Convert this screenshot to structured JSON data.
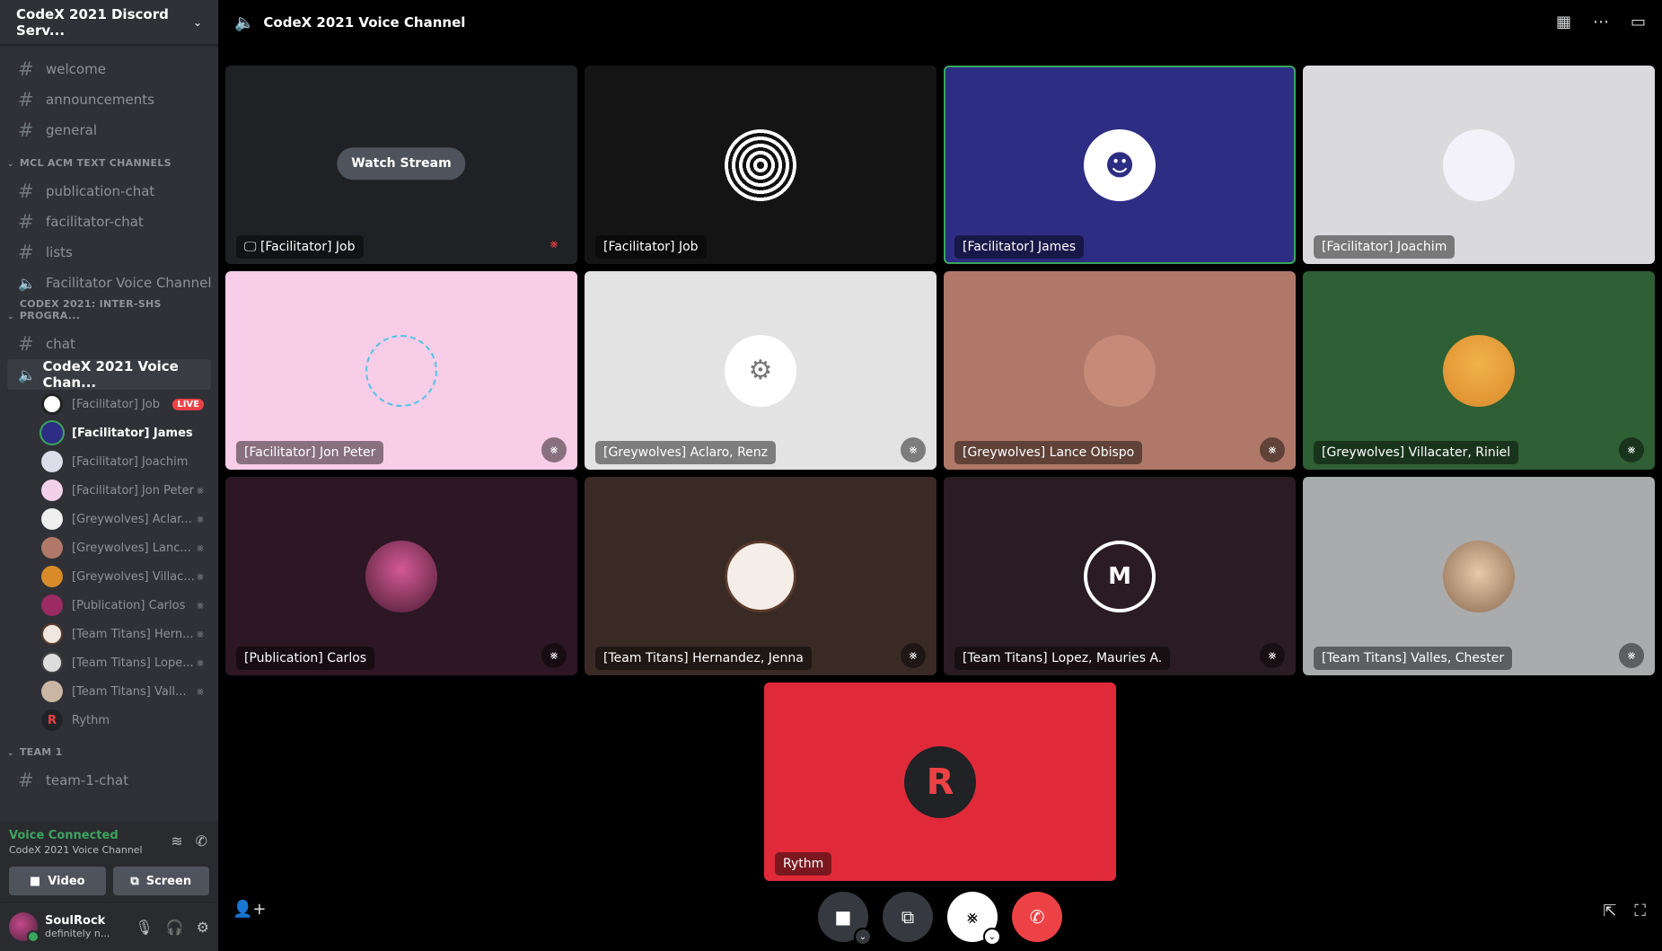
{
  "server": {
    "name": "CodeX 2021 Discord Serv..."
  },
  "channels_top": [
    {
      "label": "welcome"
    },
    {
      "label": "announcements"
    },
    {
      "label": "general"
    }
  ],
  "category1": {
    "label": "MCL ACM TEXT CHANNELS"
  },
  "channels_cat1": [
    {
      "label": "publication-chat"
    },
    {
      "label": "facilitator-chat"
    },
    {
      "label": "lists"
    }
  ],
  "facilitator_voice": {
    "label": "Facilitator Voice Channel"
  },
  "category2": {
    "label": "CODEX 2021: INTER-SHS PROGRA..."
  },
  "chat_channel": {
    "label": "chat"
  },
  "voice_channel": {
    "label": "CodeX 2021 Voice Chan..."
  },
  "members": [
    {
      "name": "[Facilitator] Job",
      "live": "LIVE"
    },
    {
      "name": "[Facilitator] James"
    },
    {
      "name": "[Facilitator] Joachim"
    },
    {
      "name": "[Facilitator] Jon Peter"
    },
    {
      "name": "[Greywolves] Aclar..."
    },
    {
      "name": "[Greywolves] Lanc..."
    },
    {
      "name": "[Greywolves] Villac..."
    },
    {
      "name": "[Publication] Carlos"
    },
    {
      "name": "[Team Titans] Hern..."
    },
    {
      "name": "[Team Titans] Lope..."
    },
    {
      "name": "[Team Titans] Vall..."
    },
    {
      "name": "Rythm"
    }
  ],
  "category3": {
    "label": "TEAM 1"
  },
  "team_channel": {
    "label": "team-1-chat"
  },
  "voice_panel": {
    "status": "Voice Connected",
    "channel": "CodeX 2021 Voice Channel ...",
    "video_label": "Video",
    "screen_label": "Screen"
  },
  "user": {
    "name": "SoulRock",
    "status": "definitely n..."
  },
  "topbar": {
    "title": "CodeX 2021 Voice Channel"
  },
  "stream": {
    "watch_label": "Watch Stream",
    "label": "[Facilitator] Job"
  },
  "tiles": [
    {
      "label": "[Facilitator] Job",
      "bg": "#141414"
    },
    {
      "label": "[Facilitator] James",
      "bg": "#2d2d84"
    },
    {
      "label": "[Facilitator] Joachim",
      "bg": "#dadadd"
    },
    {
      "label": "[Facilitator] Jon Peter",
      "bg": "#f8cde8"
    },
    {
      "label": "[Greywolves] Aclaro, Renz",
      "bg": "#e3e3e3"
    },
    {
      "label": "[Greywolves] Lance Obispo",
      "bg": "#b07868"
    },
    {
      "label": "[Greywolves] Villacater, Riniel",
      "bg": "#2f5f34"
    },
    {
      "label": "[Publication] Carlos",
      "bg": "#2d1724"
    },
    {
      "label": "[Team Titans] Hernandez, Jenna",
      "bg": "#3a2a26"
    },
    {
      "label": "[Team Titans] Lopez, Mauries A.",
      "bg": "#2a1c22"
    },
    {
      "label": "[Team Titans] Valles, Chester",
      "bg": "#a9abad"
    },
    {
      "label": "Rythm",
      "bg": "#e02a39"
    }
  ],
  "colors": {
    "accent": "#3ba55d",
    "danger": "#ed4245",
    "sidebar": "#2f3136"
  }
}
